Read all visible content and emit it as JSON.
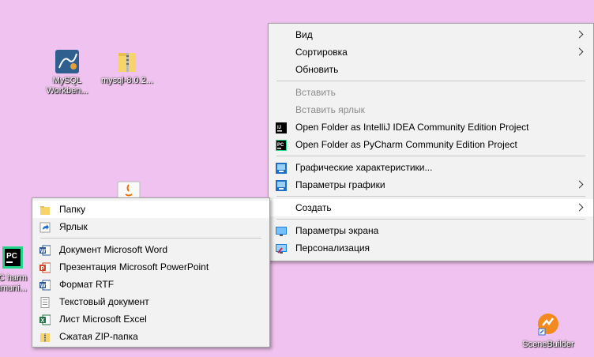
{
  "desktop": {
    "icons": [
      {
        "label": "MySQL Workben...",
        "icon": "mysql-workbench-icon"
      },
      {
        "label": "mysql-8.0.2...",
        "icon": "zip-folder-icon"
      },
      {
        "label": "PC harm mmuni...",
        "icon": "pycharm-icon"
      },
      {
        "label": "SceneBuilder",
        "icon": "scenebuilder-icon"
      },
      {
        "label": "",
        "icon": "java-icon"
      }
    ]
  },
  "context_menu": {
    "items": [
      {
        "label": "Вид",
        "submenu": true
      },
      {
        "label": "Сортировка",
        "submenu": true
      },
      {
        "label": "Обновить"
      },
      {
        "label": "Вставить",
        "disabled": true
      },
      {
        "label": "Вставить ярлык",
        "disabled": true
      },
      {
        "label": "Open Folder as IntelliJ IDEA Community Edition Project",
        "icon": "intellij-idea-icon"
      },
      {
        "label": "Open Folder as PyCharm Community Edition Project",
        "icon": "pycharm-icon"
      },
      {
        "label": "Графические характеристики...",
        "icon": "intel-graphics-icon"
      },
      {
        "label": "Параметры графики",
        "icon": "intel-graphics-icon",
        "submenu": true
      },
      {
        "label": "Создать",
        "submenu": true,
        "highlighted": true
      },
      {
        "label": "Параметры экрана",
        "icon": "display-settings-icon"
      },
      {
        "label": "Персонализация",
        "icon": "personalization-icon"
      }
    ]
  },
  "create_submenu": {
    "items": [
      {
        "label": "Папку",
        "icon": "folder-icon",
        "highlighted": true
      },
      {
        "label": "Ярлык",
        "icon": "shortcut-icon"
      },
      {
        "label": "Документ Microsoft Word",
        "icon": "word-icon"
      },
      {
        "label": "Презентация Microsoft PowerPoint",
        "icon": "powerpoint-icon"
      },
      {
        "label": "Формат RTF",
        "icon": "rtf-icon"
      },
      {
        "label": "Текстовый документ",
        "icon": "text-document-icon"
      },
      {
        "label": "Лист Microsoft Excel",
        "icon": "excel-icon"
      },
      {
        "label": "Сжатая ZIP-папка",
        "icon": "zip-folder-icon"
      }
    ]
  },
  "colors": {
    "desktop_bg": "#f0c2ef",
    "menu_bg": "#f2f2f2",
    "highlight": "#ffffff",
    "disabled_text": "#8c8c8c"
  }
}
